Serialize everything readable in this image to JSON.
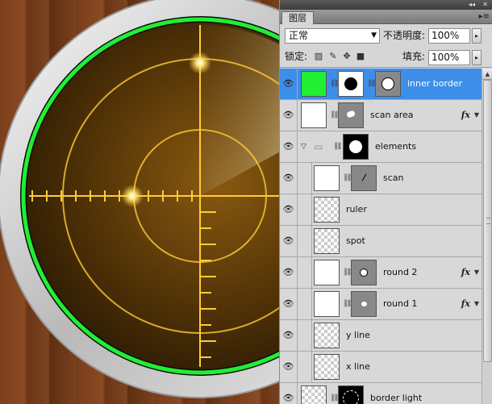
{
  "panel": {
    "tab_label": "图层",
    "collapse_glyph": "◂◂",
    "menu_glyph": "▾≡",
    "tab_menu_glyph": "▸≡",
    "blend_mode": "正常",
    "opacity_label": "不透明度:",
    "opacity_value": "100%",
    "lock_label": "锁定:",
    "fill_label": "填充:",
    "fill_value": "100%"
  },
  "icons": {
    "eye": "eye-icon",
    "link": "chain-link-icon",
    "fx": "fx-icon",
    "folder": "folder-icon",
    "lock_transparent": "lock-transparent-icon",
    "lock_image": "lock-image-icon",
    "lock_position": "lock-position-icon",
    "lock_all": "lock-all-icon"
  },
  "layers": [
    {
      "name": "inner border",
      "selected": true,
      "fx": false
    },
    {
      "name": "scan area",
      "selected": false,
      "fx": true
    },
    {
      "name": "elements",
      "selected": false,
      "fx": false,
      "group": true
    },
    {
      "name": "scan",
      "selected": false,
      "fx": false
    },
    {
      "name": "ruler",
      "selected": false,
      "fx": false
    },
    {
      "name": "spot",
      "selected": false,
      "fx": false
    },
    {
      "name": "round 2",
      "selected": false,
      "fx": true
    },
    {
      "name": "round 1",
      "selected": false,
      "fx": true
    },
    {
      "name": "y line",
      "selected": false,
      "fx": false
    },
    {
      "name": "x line",
      "selected": false,
      "fx": false
    },
    {
      "name": "border light",
      "selected": false,
      "fx": false
    }
  ],
  "colors": {
    "selection": "#3d8ee8",
    "inner_border_green": "#22ee33",
    "radar_line": "#ffcc33"
  }
}
